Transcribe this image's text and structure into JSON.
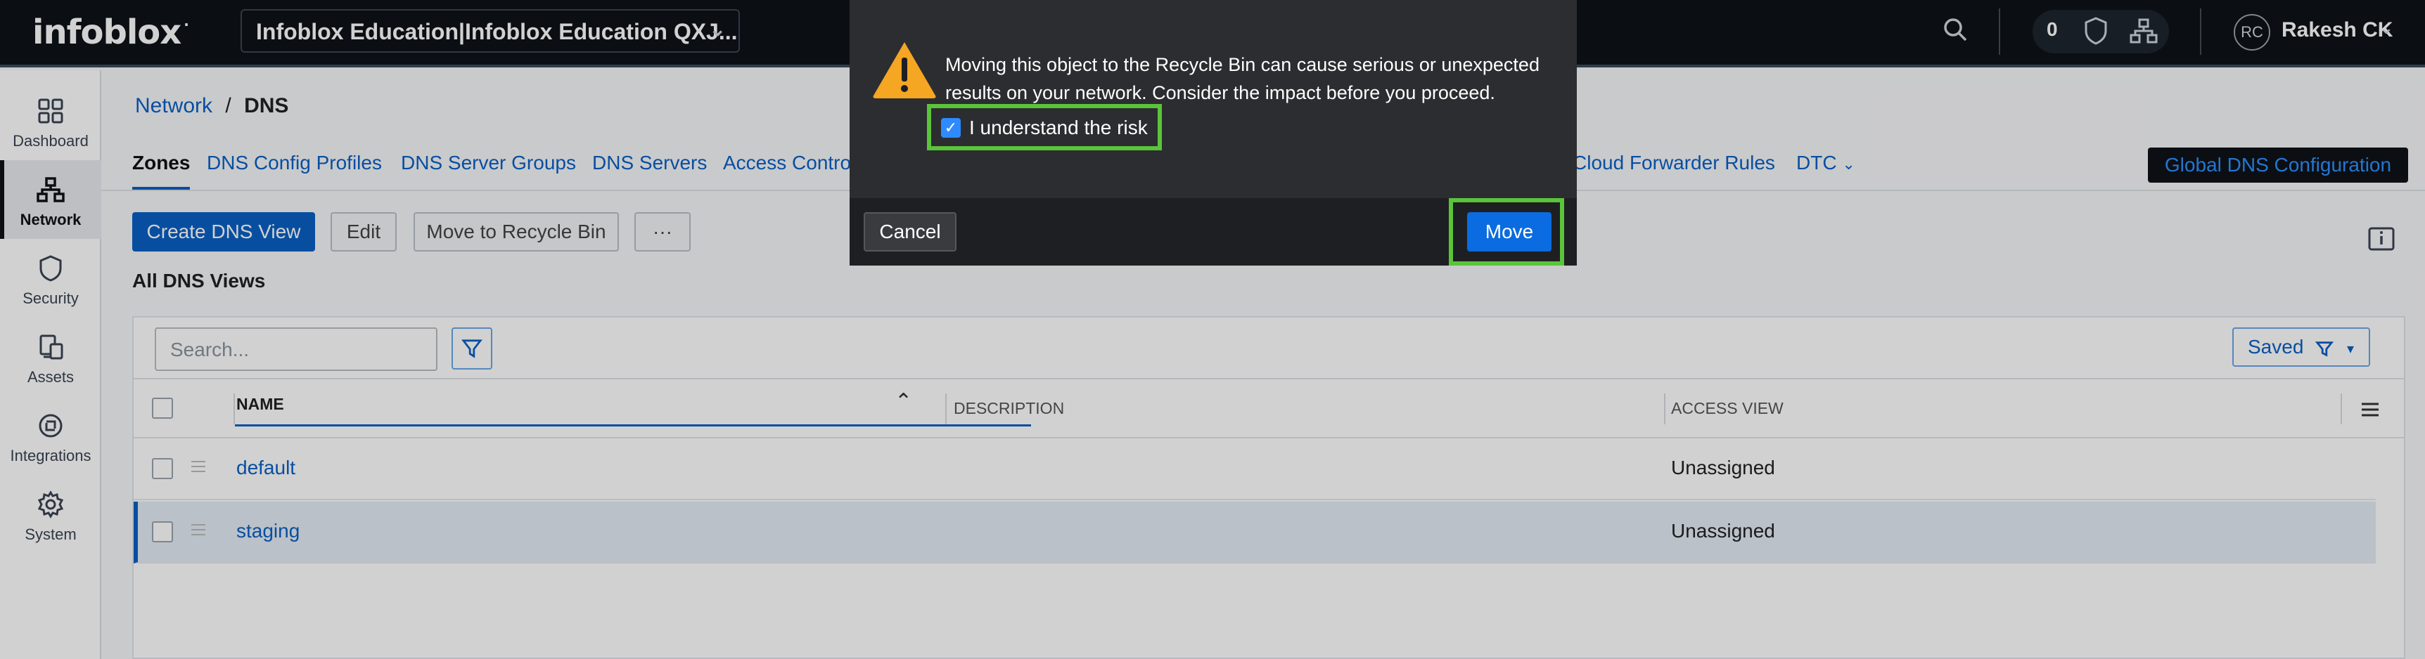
{
  "topbar": {
    "logo": "infoblox",
    "account": "Infoblox Education|Infoblox Education QXJ...",
    "notifications_count": "0",
    "user_initials": "RC",
    "user_name": "Rakesh CK"
  },
  "sidebar": {
    "items": [
      {
        "label": "Dashboard",
        "icon": "dashboard-icon"
      },
      {
        "label": "Network",
        "icon": "network-icon",
        "active": true
      },
      {
        "label": "Security",
        "icon": "shield-icon"
      },
      {
        "label": "Assets",
        "icon": "assets-icon"
      },
      {
        "label": "Integrations",
        "icon": "integrations-icon"
      },
      {
        "label": "System",
        "icon": "gear-icon"
      }
    ]
  },
  "breadcrumb": {
    "parent": "Network",
    "separator": "/",
    "current": "DNS"
  },
  "tabs": [
    {
      "label": "Zones",
      "active": true
    },
    {
      "label": "DNS Config Profiles"
    },
    {
      "label": "DNS Server Groups"
    },
    {
      "label": "DNS Servers"
    },
    {
      "label": "Access Contro"
    },
    {
      "label": "Cloud Forwarder Rules"
    },
    {
      "label": "DTC"
    }
  ],
  "global_dns_button": "Global DNS Configuration",
  "toolbar": {
    "create": "Create DNS View",
    "edit": "Edit",
    "recycle": "Move to Recycle Bin",
    "more": "···"
  },
  "section_title": "All DNS Views",
  "grid": {
    "search_placeholder": "Search...",
    "saved_label": "Saved",
    "columns": {
      "name": "NAME",
      "description": "DESCRIPTION",
      "access_view": "ACCESS VIEW"
    },
    "rows": [
      {
        "name": "default",
        "description": "",
        "access_view": "Unassigned",
        "selected": false
      },
      {
        "name": "staging",
        "description": "",
        "access_view": "Unassigned",
        "selected": true
      }
    ]
  },
  "modal": {
    "message": "Moving this object to the Recycle Bin can cause serious or unexpected results on your network. Consider the impact before you proceed.",
    "risk_label": "I understand the risk",
    "risk_checked": true,
    "cancel": "Cancel",
    "move": "Move"
  },
  "colors": {
    "accent": "#0a60c4",
    "highlight": "#5ac43a",
    "topbar": "#0e1319"
  }
}
